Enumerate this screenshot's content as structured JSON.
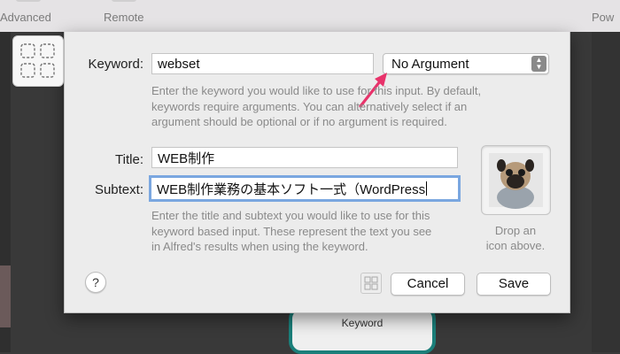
{
  "toolbar": {
    "advanced_label": "Advanced",
    "remote_label": "Remote",
    "powerpack_label": "Pow"
  },
  "dialog": {
    "keyword_label": "Keyword:",
    "keyword_value": "webset",
    "argument_select": "No Argument",
    "keyword_help": [
      "Enter the keyword you would like to use for this input. By default,",
      "keywords require arguments. You can alternatively select if an",
      "argument should be optional or if no argument is required."
    ],
    "title_label": "Title:",
    "title_value": "WEB制作",
    "subtext_label": "Subtext:",
    "subtext_value": "WEB制作業務の基本ソフト一式（WordPress",
    "subtext_help": [
      "Enter the title and subtext you would like to use for this",
      "keyword based input. These represent the text you see",
      "in Alfred's results when using the keyword."
    ],
    "drop_icon": [
      "Drop an",
      "icon above."
    ],
    "help_button": "?",
    "cancel_button": "Cancel",
    "save_button": "Save"
  },
  "canvas": {
    "node_label": "Keyword"
  },
  "colors": {
    "accent_arrow": "#e8336b",
    "node_border": "#1b7f7a",
    "focus_ring": "#7aa7e0"
  }
}
